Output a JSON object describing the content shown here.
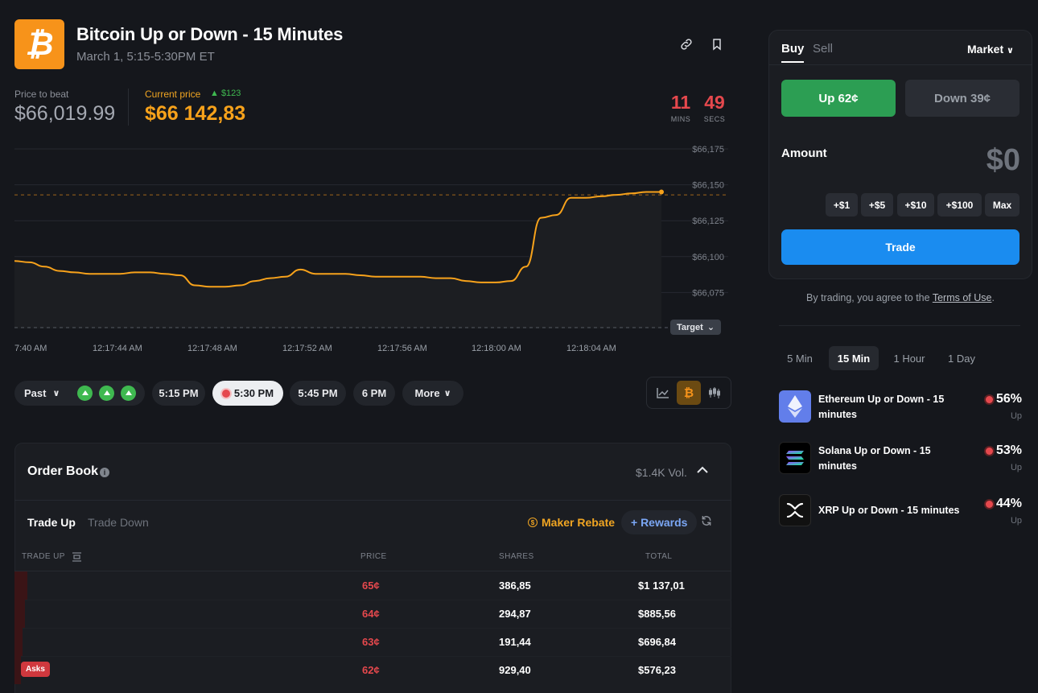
{
  "header": {
    "logo_symbol": "₿",
    "title": "Bitcoin Up or Down - 15 Minutes",
    "subtitle": "March 1, 5:15-5:30PM ET",
    "icons": [
      "link-icon",
      "bookmark-icon"
    ]
  },
  "prices": {
    "price_to_beat_label": "Price to beat",
    "price_to_beat": "$66,019.99",
    "current_label": "Current price",
    "current_delta": "▲ $123",
    "current_price": "$66 142,83"
  },
  "timer": {
    "mins": "11",
    "mins_label": "MINS",
    "secs": "49",
    "secs_label": "SECS"
  },
  "chart_data": {
    "type": "line",
    "y_ticks": [
      "$66,175",
      "$66,150",
      "$66,125",
      "$66,100",
      "$66,075"
    ],
    "ylim": [
      66050,
      66175
    ],
    "x_tick_labels": [
      "7:40 AM",
      "12:17:44 AM",
      "12:17:48 AM",
      "12:17:52 AM",
      "12:17:56 AM",
      "12:18:00 AM",
      "12:18:04 AM"
    ],
    "target_value": 66055,
    "current_value": 66143,
    "series": [
      {
        "values": [
          66097,
          66096,
          66093,
          66090,
          66089,
          66088,
          66088,
          66088,
          66089,
          66089,
          66088,
          66087,
          66080,
          66079,
          66079,
          66080,
          66083,
          66085,
          66086,
          66091,
          66088,
          66088,
          66088,
          66087,
          66086,
          66086,
          66086,
          66086,
          66085,
          66085,
          66083,
          66082,
          66082,
          66083,
          66093,
          66127,
          66129,
          66141,
          66141,
          66142,
          66143,
          66144,
          66145,
          66145
        ]
      }
    ],
    "grid": true
  },
  "chart_ui": {
    "target_label": "Target"
  },
  "intervals": {
    "past_label": "Past",
    "items": [
      "5:15 PM",
      "5:30 PM",
      "5:45 PM",
      "6 PM"
    ],
    "active": "5:30 PM",
    "more_label": "More"
  },
  "order_book": {
    "title": "Order Book",
    "volume": "$1.4K Vol.",
    "tab_up": "Trade Up",
    "tab_down": "Trade Down",
    "maker_rebate": "Maker Rebate",
    "rewards": "+ Rewards",
    "columns": [
      "TRADE UP",
      "PRICE",
      "SHARES",
      "TOTAL"
    ],
    "rows": [
      {
        "price": "65¢",
        "shares": "386,85",
        "total": "$1 137,01",
        "depth": 1.0
      },
      {
        "price": "64¢",
        "shares": "294,87",
        "total": "$885,56",
        "depth": 0.8
      },
      {
        "price": "63¢",
        "shares": "191,44",
        "total": "$696,84",
        "depth": 0.65
      },
      {
        "price": "62¢",
        "shares": "929,40",
        "total": "$576,23",
        "depth": 0.5
      }
    ],
    "asks_badge": "Asks"
  },
  "trade": {
    "buy_label": "Buy",
    "sell_label": "Sell",
    "order_type": "Market",
    "up_label": "Up 62¢",
    "down_label": "Down 39¢",
    "amount_label": "Amount",
    "amount_value": "$0",
    "quick_amounts": [
      "+$1",
      "+$5",
      "+$10",
      "+$100",
      "Max"
    ],
    "trade_button": "Trade",
    "terms_prefix": "By trading, you agree to the",
    "terms_link": "Terms of Use",
    "terms_suffix": "."
  },
  "filters": [
    "5 Min",
    "15 Min",
    "1 Hour",
    "1 Day"
  ],
  "filter_active": "15 Min",
  "markets": [
    {
      "title": "Ethereum Up or Down - 15 minutes",
      "pct": "56%",
      "dir": "Up",
      "icon": "ethereum-icon",
      "color": "#627eea"
    },
    {
      "title": "Solana Up or Down - 15 minutes",
      "pct": "53%",
      "dir": "Up",
      "icon": "solana-icon",
      "color": "#000000"
    },
    {
      "title": "XRP Up or Down - 15 minutes",
      "pct": "44%",
      "dir": "Up",
      "icon": "xrp-icon",
      "color": "#111111"
    }
  ],
  "colors": {
    "accent_orange": "#f7931a",
    "up_green": "#2c9e53",
    "down_red": "#e5484d",
    "trade_blue": "#1a8cf0"
  }
}
